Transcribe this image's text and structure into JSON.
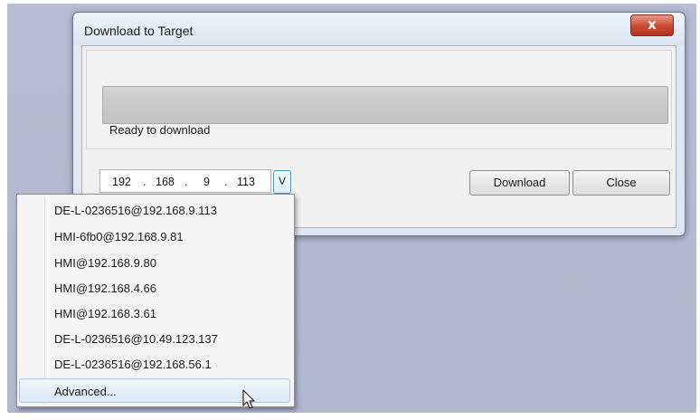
{
  "window": {
    "title": "Download to Target",
    "close_glyph": "x"
  },
  "progress": {
    "value": 0,
    "status": "Ready to download"
  },
  "ip_address": {
    "octet1": "192",
    "octet2": "168",
    "octet3": "9",
    "octet4": "113",
    "separator": "."
  },
  "dropdown_button_label": "V",
  "buttons": {
    "download": "Download",
    "close": "Close"
  },
  "dropdown": {
    "items": [
      {
        "label": "DE-L-0236516@192.168.9.113"
      },
      {
        "label": "HMI-6fb0@192.168.9.81"
      },
      {
        "label": "HMI@192.168.9.80"
      },
      {
        "label": "HMI@192.168.4.66"
      },
      {
        "label": "HMI@192.168.3.61"
      },
      {
        "label": "DE-L-0236516@10.49.123.137"
      },
      {
        "label": "DE-L-0236516@192.168.56.1"
      },
      {
        "label": "Advanced..."
      }
    ],
    "hovered_item": "Advanced..."
  },
  "colors": {
    "desktop": "#b3bad1",
    "close_button": "#c84a32",
    "combo_accent": "#3c9bd6",
    "hover_highlight": "#dbe9f7"
  },
  "icons": [
    "close-icon",
    "mouse-pointer-icon"
  ]
}
